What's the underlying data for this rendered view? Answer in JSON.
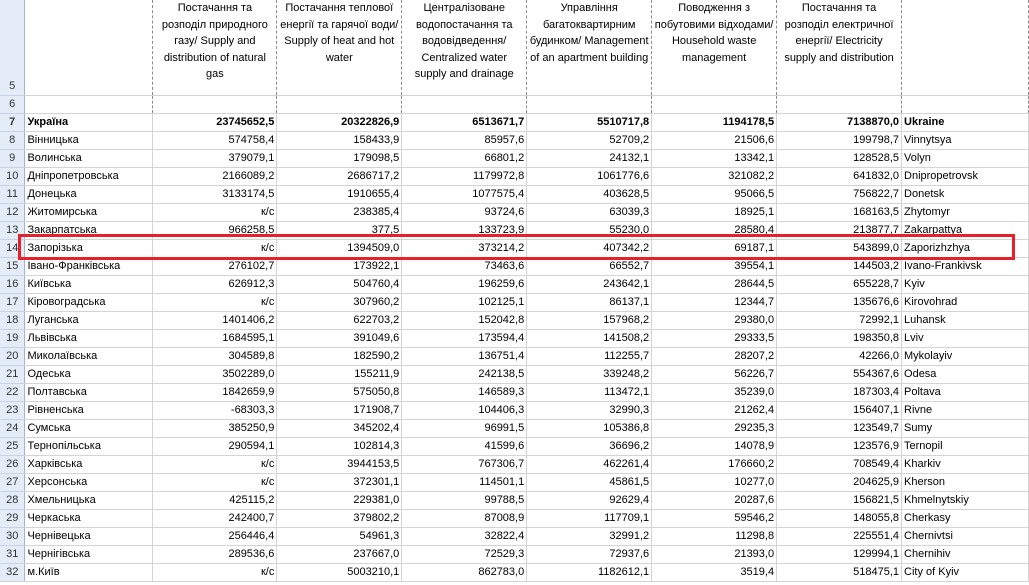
{
  "header_row_number": "5",
  "empty_row_number": "6",
  "columns": [
    "Постачання та розподіл природного газу/ Supply and distribution of natural gas",
    "Постачання теплової енергії та гарячої води/ Supply of heat and hot water",
    "Централізоване водопостачання та водовідведення/ Centralized water supply and drainage",
    "Управління багатоквартирним будинком/ Management of an apartment building",
    "Поводження з побутовими відходами/ Household waste management",
    "Постачання та розподіл електричної енергії/ Electricity supply and distribution"
  ],
  "highlight_color": "#e8202a",
  "rows": [
    {
      "n": "7",
      "ua": "Україна",
      "v": [
        "23745652,5",
        "20322826,9",
        "6513671,7",
        "5510717,8",
        "1194178,5",
        "7138870,0"
      ],
      "en": "Ukraine"
    },
    {
      "n": "8",
      "ua": "Вінницька",
      "v": [
        "574758,4",
        "158433,9",
        "85957,6",
        "52709,2",
        "21506,6",
        "199798,7"
      ],
      "en": "Vinnytsya"
    },
    {
      "n": "9",
      "ua": "Волинська",
      "v": [
        "379079,1",
        "179098,5",
        "66801,2",
        "24132,1",
        "13342,1",
        "128528,5"
      ],
      "en": "Volyn"
    },
    {
      "n": "10",
      "ua": "Дніпропетровська",
      "v": [
        "2166089,2",
        "2686717,2",
        "1179972,8",
        "1061776,6",
        "321082,2",
        "641832,0"
      ],
      "en": "Dnipropetrovsk"
    },
    {
      "n": "11",
      "ua": "Донецька",
      "v": [
        "3133174,5",
        "1910655,4",
        "1077575,4",
        "403628,5",
        "95066,5",
        "756822,7"
      ],
      "en": "Donetsk"
    },
    {
      "n": "12",
      "ua": "Житомирська",
      "v": [
        "к/с",
        "238385,4",
        "93724,6",
        "63039,3",
        "18925,1",
        "168163,5"
      ],
      "en": "Zhytomyr"
    },
    {
      "n": "13",
      "ua": "Закарпатська",
      "v": [
        "966258,5",
        "377,5",
        "133723,9",
        "55230,0",
        "28580,4",
        "213877,7"
      ],
      "en": "Zakarpattya"
    },
    {
      "n": "14",
      "ua": "Запорізька",
      "v": [
        "к/с",
        "1394509,0",
        "373214,2",
        "407342,2",
        "69187,1",
        "543899,0"
      ],
      "en": "Zaporizhzhya"
    },
    {
      "n": "15",
      "ua": "Івано-Франківська",
      "v": [
        "276102,7",
        "173922,1",
        "73463,6",
        "66552,7",
        "39554,1",
        "144503,2"
      ],
      "en": "Ivano-Frankivsk"
    },
    {
      "n": "16",
      "ua": "Київська",
      "v": [
        "626912,3",
        "504760,4",
        "196259,6",
        "243642,1",
        "28644,5",
        "655228,7"
      ],
      "en": "Kyiv"
    },
    {
      "n": "17",
      "ua": "Кіровоградська",
      "v": [
        "к/с",
        "307960,2",
        "102125,1",
        "86137,1",
        "12344,7",
        "135676,6"
      ],
      "en": "Kirovohrad"
    },
    {
      "n": "18",
      "ua": "Луганська",
      "v": [
        "1401406,2",
        "622703,2",
        "152042,8",
        "157968,2",
        "29380,0",
        "72992,1"
      ],
      "en": "Luhansk"
    },
    {
      "n": "19",
      "ua": "Львівська",
      "v": [
        "1684595,1",
        "391049,6",
        "173594,4",
        "141508,2",
        "29333,5",
        "198350,8"
      ],
      "en": "Lviv"
    },
    {
      "n": "20",
      "ua": "Миколаївська",
      "v": [
        "304589,8",
        "182590,2",
        "136751,4",
        "112255,7",
        "28207,2",
        "42266,0"
      ],
      "en": "Mykolayiv"
    },
    {
      "n": "21",
      "ua": "Одеська",
      "v": [
        "3502289,0",
        "155211,9",
        "242138,5",
        "339248,2",
        "56226,7",
        "554367,6"
      ],
      "en": "Odesa"
    },
    {
      "n": "22",
      "ua": "Полтавська",
      "v": [
        "1842659,9",
        "575050,8",
        "146589,3",
        "113472,1",
        "35239,0",
        "187303,4"
      ],
      "en": "Poltava"
    },
    {
      "n": "23",
      "ua": "Рівненська",
      "v": [
        "-68303,3",
        "171908,7",
        "104406,3",
        "32990,3",
        "21262,4",
        "156407,1"
      ],
      "en": "Rivne"
    },
    {
      "n": "24",
      "ua": "Сумська",
      "v": [
        "385250,9",
        "345202,4",
        "96991,5",
        "105386,8",
        "29235,3",
        "123549,7"
      ],
      "en": "Sumy"
    },
    {
      "n": "25",
      "ua": "Тернопільська",
      "v": [
        "290594,1",
        "102814,3",
        "41599,6",
        "36696,2",
        "14078,9",
        "123576,9"
      ],
      "en": "Ternopil"
    },
    {
      "n": "26",
      "ua": "Харківська",
      "v": [
        "к/с",
        "3944153,5",
        "767306,7",
        "462261,4",
        "176660,2",
        "708549,4"
      ],
      "en": "Kharkiv"
    },
    {
      "n": "27",
      "ua": "Херсонська",
      "v": [
        "к/с",
        "372301,1",
        "114501,1",
        "45861,5",
        "10277,0",
        "204625,9"
      ],
      "en": "Kherson"
    },
    {
      "n": "28",
      "ua": "Хмельницька",
      "v": [
        "425115,2",
        "229381,0",
        "99788,5",
        "92629,4",
        "20287,6",
        "156821,5"
      ],
      "en": "Khmelnytskiy"
    },
    {
      "n": "29",
      "ua": "Черкаська",
      "v": [
        "242400,7",
        "379802,2",
        "87008,9",
        "117709,1",
        "59546,2",
        "148055,8"
      ],
      "en": "Cherkasy"
    },
    {
      "n": "30",
      "ua": "Чернівецька",
      "v": [
        "256446,4",
        "54961,3",
        "32822,4",
        "32991,2",
        "11298,8",
        "225551,4"
      ],
      "en": "Chernivtsi"
    },
    {
      "n": "31",
      "ua": "Чернігівська",
      "v": [
        "289536,6",
        "237667,0",
        "72529,3",
        "72937,6",
        "21393,0",
        "129994,1"
      ],
      "en": "Chernihiv"
    },
    {
      "n": "32",
      "ua": "м.Київ",
      "v": [
        "к/с",
        "5003210,1",
        "862783,0",
        "1182612,1",
        "3519,4",
        "518475,1"
      ],
      "en": "City of Kyiv"
    }
  ]
}
